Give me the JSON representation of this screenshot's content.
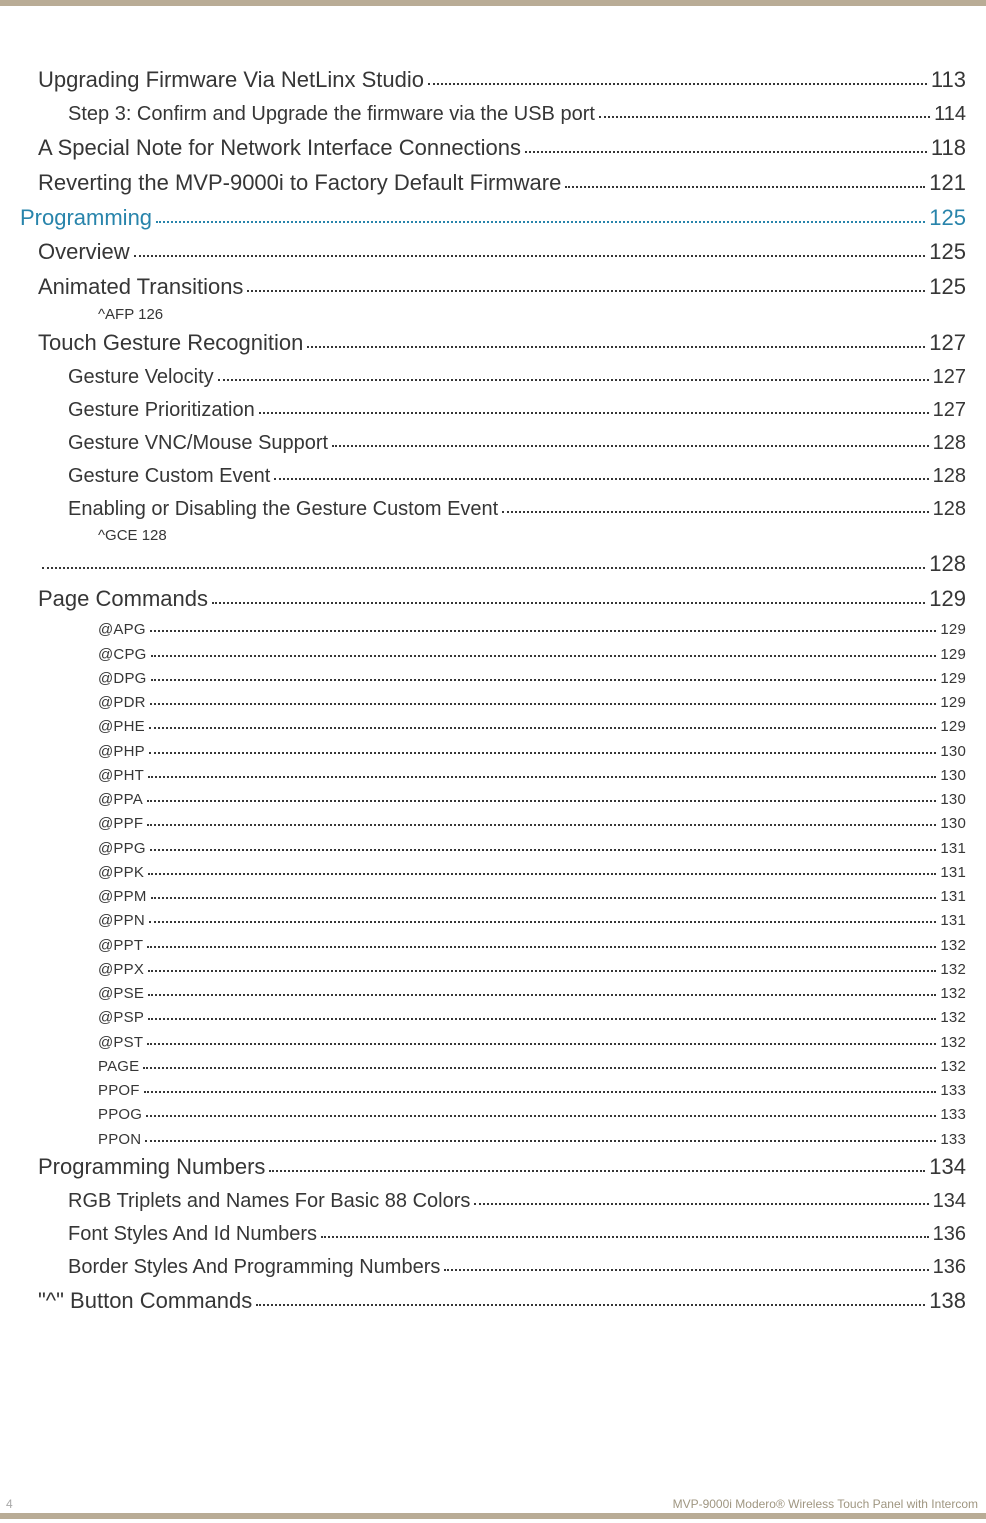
{
  "footer": {
    "page_number": "4",
    "doc_title": "MVP-9000i Modero® Wireless Touch Panel with Intercom"
  },
  "toc": [
    {
      "level": "h1",
      "label": "Upgrading Firmware Via NetLinx Studio",
      "page": "113"
    },
    {
      "level": "h2",
      "label": "Step 3: Confirm and Upgrade the firmware via the USB port",
      "page": "114"
    },
    {
      "level": "h1",
      "label": "A Special Note for Network Interface Connections",
      "page": "118"
    },
    {
      "level": "h1",
      "label": "Reverting the MVP-9000i to Factory Default Firmware",
      "page": "121"
    },
    {
      "level": "chapter",
      "label": "Programming",
      "page": "125"
    },
    {
      "level": "h1",
      "label": "Overview",
      "page": "125"
    },
    {
      "level": "h1",
      "label": "Animated Transitions",
      "page": "125"
    },
    {
      "level": "h3nl",
      "label": "^AFP 126"
    },
    {
      "level": "h1",
      "label": "Touch Gesture Recognition",
      "page": "127"
    },
    {
      "level": "h2",
      "label": "Gesture Velocity",
      "page": "127"
    },
    {
      "level": "h2",
      "label": "Gesture Prioritization",
      "page": "127"
    },
    {
      "level": "h2",
      "label": "Gesture VNC/Mouse Support",
      "page": "128"
    },
    {
      "level": "h2",
      "label": "Gesture Custom Event",
      "page": "128"
    },
    {
      "level": "h2",
      "label": "Enabling or Disabling the Gesture Custom Event",
      "page": "128"
    },
    {
      "level": "h3nl",
      "label": "^GCE 128"
    },
    {
      "level": "blank",
      "label": "",
      "page": "128"
    },
    {
      "level": "h1",
      "label": "Page Commands",
      "page": "129"
    },
    {
      "level": "h3",
      "label": "@APG",
      "page": "129"
    },
    {
      "level": "h3",
      "label": "@CPG",
      "page": "129"
    },
    {
      "level": "h3",
      "label": "@DPG",
      "page": "129"
    },
    {
      "level": "h3",
      "label": "@PDR",
      "page": "129"
    },
    {
      "level": "h3",
      "label": "@PHE",
      "page": "129"
    },
    {
      "level": "h3",
      "label": "@PHP",
      "page": "130"
    },
    {
      "level": "h3",
      "label": "@PHT",
      "page": "130"
    },
    {
      "level": "h3",
      "label": "@PPA",
      "page": "130"
    },
    {
      "level": "h3",
      "label": "@PPF",
      "page": "130"
    },
    {
      "level": "h3",
      "label": "@PPG",
      "page": "131"
    },
    {
      "level": "h3",
      "label": "@PPK",
      "page": "131"
    },
    {
      "level": "h3",
      "label": "@PPM",
      "page": "131"
    },
    {
      "level": "h3",
      "label": "@PPN",
      "page": "131"
    },
    {
      "level": "h3",
      "label": "@PPT",
      "page": "132"
    },
    {
      "level": "h3",
      "label": "@PPX",
      "page": "132"
    },
    {
      "level": "h3",
      "label": "@PSE",
      "page": "132"
    },
    {
      "level": "h3",
      "label": "@PSP",
      "page": "132"
    },
    {
      "level": "h3",
      "label": "@PST",
      "page": "132"
    },
    {
      "level": "h3",
      "label": "PAGE",
      "page": "132"
    },
    {
      "level": "h3",
      "label": "PPOF",
      "page": "133"
    },
    {
      "level": "h3",
      "label": "PPOG",
      "page": "133"
    },
    {
      "level": "h3",
      "label": "PPON",
      "page": "133"
    },
    {
      "level": "h1",
      "label": "Programming Numbers",
      "page": "134"
    },
    {
      "level": "h2",
      "label": "RGB Triplets and Names For Basic 88 Colors",
      "page": "134"
    },
    {
      "level": "h2",
      "label": "Font Styles And Id Numbers",
      "page": "136"
    },
    {
      "level": "h2",
      "label": "Border Styles And Programming Numbers",
      "page": "136"
    },
    {
      "level": "h1",
      "label": "\"^\" Button Commands",
      "page": "138"
    }
  ]
}
